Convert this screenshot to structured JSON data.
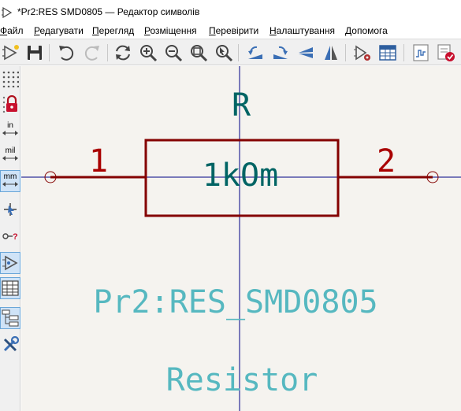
{
  "window": {
    "title": "*Pr2:RES SMD0805 — Редактор символів"
  },
  "menu": {
    "items": [
      {
        "u": "Ф",
        "rest": "айл"
      },
      {
        "u": "Р",
        "rest": "едагувати"
      },
      {
        "u": "П",
        "rest": "ерегляд"
      },
      {
        "u": "Р",
        "rest": "озміщення"
      },
      {
        "u": "П",
        "rest": "еревірити"
      },
      {
        "u": "Н",
        "rest": "алаштування"
      },
      {
        "u": "Д",
        "rest": "опомога"
      }
    ]
  },
  "left_toolbar": {
    "unit_in": "in",
    "unit_mil": "mil",
    "unit_mm": "mm"
  },
  "symbol": {
    "reference": "R",
    "value": "1kOm",
    "pin1_number": "1",
    "pin2_number": "2",
    "library_id": "Pr2:RES_SMD0805",
    "description": "Resistor"
  },
  "colors": {
    "body": "#840000",
    "pin": "#840000",
    "pin_number": "#a90000",
    "reference": "#006464",
    "value": "#006464",
    "fields": "#56b8c0",
    "axis": "#000084",
    "background": "#f5f3ef"
  }
}
